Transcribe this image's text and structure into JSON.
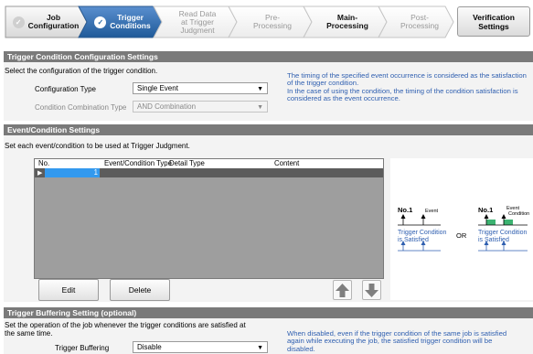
{
  "steps": [
    {
      "label": "Job\nConfiguration",
      "state": "done"
    },
    {
      "label": "Trigger\nConditions",
      "state": "current"
    },
    {
      "label": "Read Data\nat Trigger\nJudgment",
      "state": "pending"
    },
    {
      "label": "Pre-\nProcessing",
      "state": "pending"
    },
    {
      "label": "Main-\nProcessing",
      "state": "pending-dark"
    },
    {
      "label": "Post-\nProcessing",
      "state": "pending"
    }
  ],
  "verification_button": "Verification\nSettings",
  "trigger_condition": {
    "header": "Trigger Condition Configuration Settings",
    "instruction": "Select the configuration of the trigger condition.",
    "config_type_label": "Configuration Type",
    "config_type_value": "Single Event",
    "combination_label": "Condition Combination Type",
    "combination_value": "AND Combination",
    "note": "The timing of the specified event occurrence is considered as the satisfaction of the trigger condition.\nIn the case of using the condition, the timing of the condition satisfaction is considered as the event occurrence."
  },
  "event_condition": {
    "header": "Event/Condition Settings",
    "instruction": "Set each event/condition to be used at Trigger Judgment.",
    "columns": [
      "No.",
      "Event/Condition Type",
      "Detail Type",
      "Content"
    ],
    "rows": [
      {
        "no": "1",
        "type": "",
        "detail": "",
        "content": ""
      }
    ],
    "edit_button": "Edit",
    "delete_button": "Delete"
  },
  "diagram": {
    "left_no": "No.1",
    "left_event": "Event",
    "left_caption": "Trigger Condition\nis Satisfied",
    "or_label": "OR",
    "right_no": "No.1",
    "right_event": "Event",
    "right_condition": "Condition",
    "right_caption": "Trigger Condition\nis Satisfied",
    "accent_color": "#2f5fb0",
    "condition_color": "#3cb371"
  },
  "buffering": {
    "header": "Trigger Buffering Setting (optional)",
    "instruction": "Set the operation of the job whenever the trigger conditions are satisfied at\nthe same time.",
    "label": "Trigger Buffering",
    "value": "Disable",
    "note": "When disabled, even if the trigger condition of the same job is satisfied\nagain while executing the job, the satisfied trigger condition will be\ndisabled."
  }
}
